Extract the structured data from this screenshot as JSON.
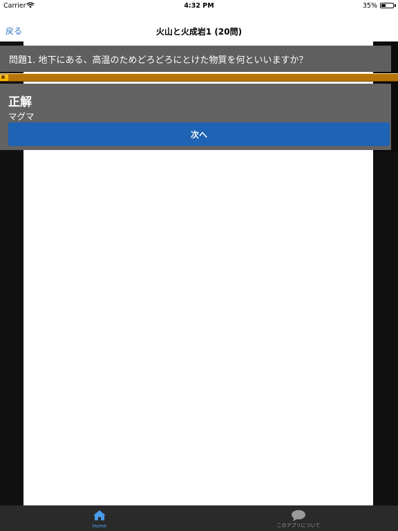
{
  "status_bar": {
    "carrier": "Carrier",
    "time": "4:32 PM",
    "battery": "35%",
    "battery_level": 0.35
  },
  "nav": {
    "back_label": "戻る",
    "title": "火山と火成岩1 (20問)"
  },
  "question": {
    "text": "問題1. 地下にある、高温のためどろどろにとけた物質を何といいますか？"
  },
  "progress": {
    "fraction": 0.02
  },
  "answer": {
    "result": "正解",
    "text": "マグマ",
    "next_label": "次へ"
  },
  "tab_bar": {
    "home_label": "Home",
    "about_label": "このアプリについて",
    "home_color": "#4a9bea",
    "inactive_color": "#9a9a9a"
  },
  "colors": {
    "accent": "#3478c8",
    "button": "#1e63b4",
    "progress": "#ffb800"
  }
}
